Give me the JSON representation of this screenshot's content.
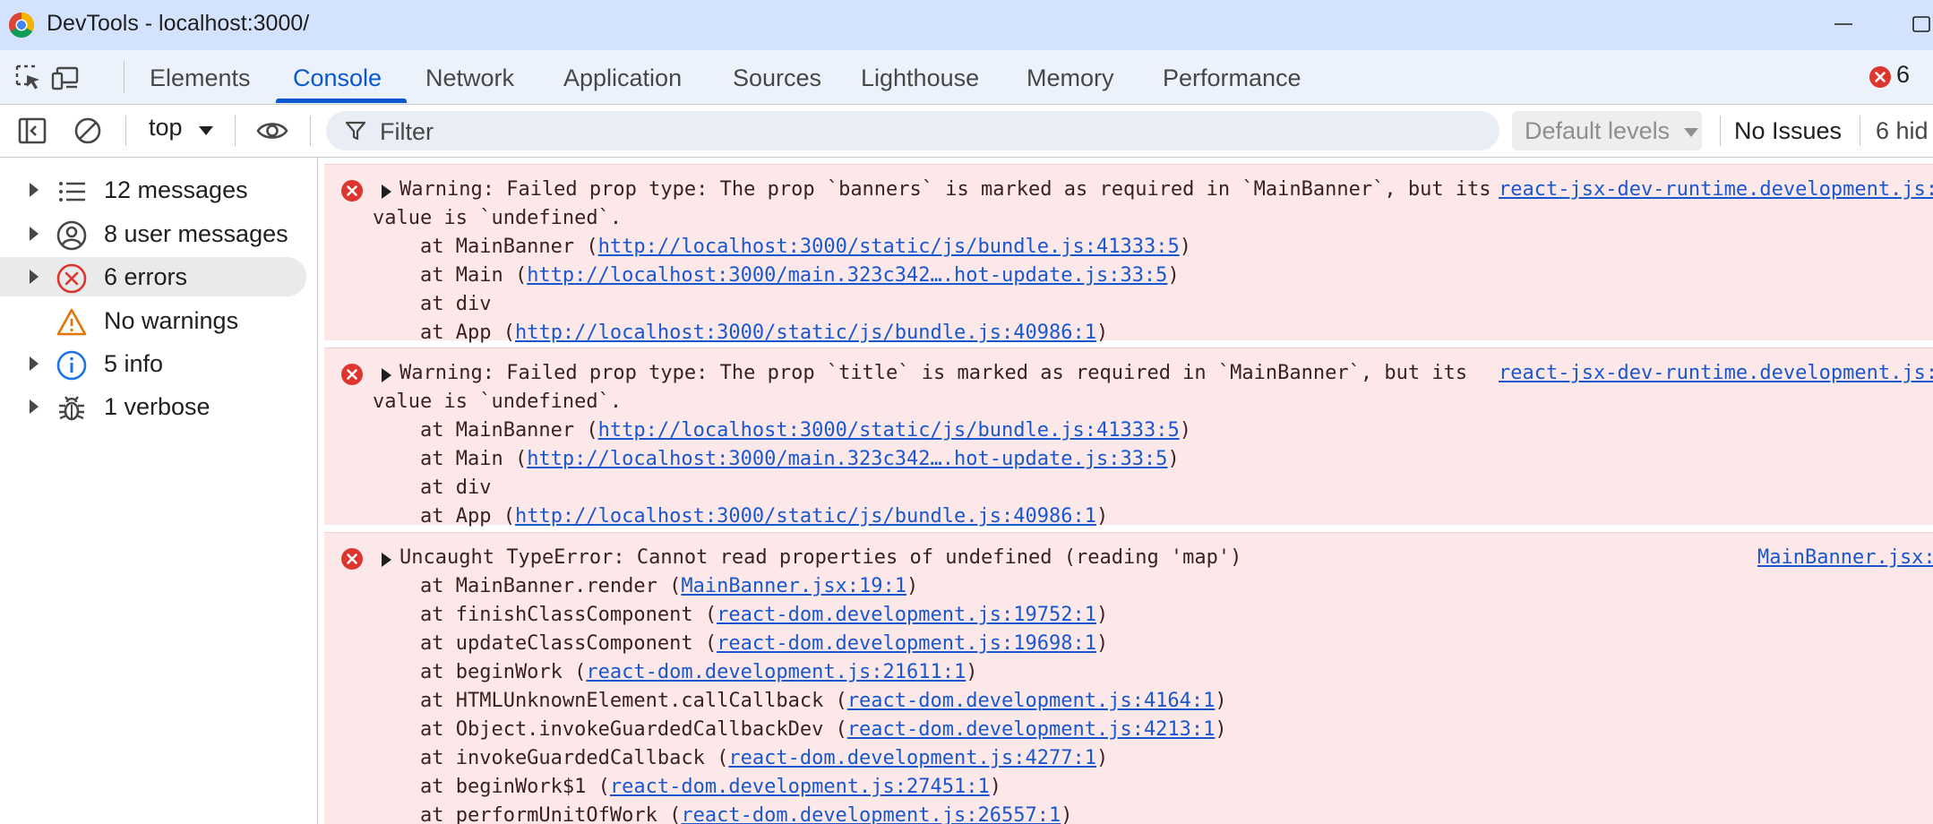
{
  "window": {
    "title": "DevTools - localhost:3000/"
  },
  "tabs": [
    {
      "label": "Elements"
    },
    {
      "label": "Console"
    },
    {
      "label": "Network"
    },
    {
      "label": "Application"
    },
    {
      "label": "Sources"
    },
    {
      "label": "Lighthouse"
    },
    {
      "label": "Memory"
    },
    {
      "label": "Performance"
    }
  ],
  "active_tab": "Console",
  "error_badge": {
    "count": "6"
  },
  "toolbar": {
    "context": "top",
    "filter_placeholder": "Filter",
    "levels": "Default levels",
    "issues": "No Issues",
    "hidden": "6 hid"
  },
  "sidebar": {
    "items": [
      {
        "label": "12 messages",
        "icon": "list-icon"
      },
      {
        "label": "8 user messages",
        "icon": "user-icon"
      },
      {
        "label": "6 errors",
        "icon": "error-icon"
      },
      {
        "label": "No warnings",
        "icon": "warning-icon"
      },
      {
        "label": "5 info",
        "icon": "info-icon"
      },
      {
        "label": "1 verbose",
        "icon": "bug-icon"
      }
    ]
  },
  "messages": [
    {
      "line1": "Warning: Failed prop type: The prop `banners` is marked as required in `MainBanner`, but its",
      "line2": "value is `undefined`.",
      "source": "react-jsx-dev-runtime.development.js:",
      "stack": [
        {
          "pre": "    at MainBanner (",
          "link": "http://localhost:3000/static/js/bundle.js:41333:5",
          "post": ")"
        },
        {
          "pre": "    at Main (",
          "link": "http://localhost:3000/main.323c342….hot-update.js:33:5",
          "post": ")"
        },
        {
          "pre": "    at div",
          "link": "",
          "post": ""
        },
        {
          "pre": "    at App (",
          "link": "http://localhost:3000/static/js/bundle.js:40986:1",
          "post": ")"
        }
      ]
    },
    {
      "line1": "Warning: Failed prop type: The prop `title` is marked as required in `MainBanner`, but its",
      "line2": "value is `undefined`.",
      "source": "react-jsx-dev-runtime.development.js:",
      "stack": [
        {
          "pre": "    at MainBanner (",
          "link": "http://localhost:3000/static/js/bundle.js:41333:5",
          "post": ")"
        },
        {
          "pre": "    at Main (",
          "link": "http://localhost:3000/main.323c342….hot-update.js:33:5",
          "post": ")"
        },
        {
          "pre": "    at div",
          "link": "",
          "post": ""
        },
        {
          "pre": "    at App (",
          "link": "http://localhost:3000/static/js/bundle.js:40986:1",
          "post": ")"
        }
      ]
    },
    {
      "line1": "Uncaught TypeError: Cannot read properties of undefined (reading 'map')",
      "source": "MainBanner.jsx:",
      "stack": [
        {
          "pre": "    at MainBanner.render (",
          "link": "MainBanner.jsx:19:1",
          "post": ")"
        },
        {
          "pre": "    at finishClassComponent (",
          "link": "react-dom.development.js:19752:1",
          "post": ")"
        },
        {
          "pre": "    at updateClassComponent (",
          "link": "react-dom.development.js:19698:1",
          "post": ")"
        },
        {
          "pre": "    at beginWork (",
          "link": "react-dom.development.js:21611:1",
          "post": ")"
        },
        {
          "pre": "    at HTMLUnknownElement.callCallback (",
          "link": "react-dom.development.js:4164:1",
          "post": ")"
        },
        {
          "pre": "    at Object.invokeGuardedCallbackDev (",
          "link": "react-dom.development.js:4213:1",
          "post": ")"
        },
        {
          "pre": "    at invokeGuardedCallback (",
          "link": "react-dom.development.js:4277:1",
          "post": ")"
        },
        {
          "pre": "    at beginWork$1 (",
          "link": "react-dom.development.js:27451:1",
          "post": ")"
        },
        {
          "pre": "    at performUnitOfWork (",
          "link": "react-dom.development.js:26557:1",
          "post": ")"
        }
      ]
    }
  ]
}
